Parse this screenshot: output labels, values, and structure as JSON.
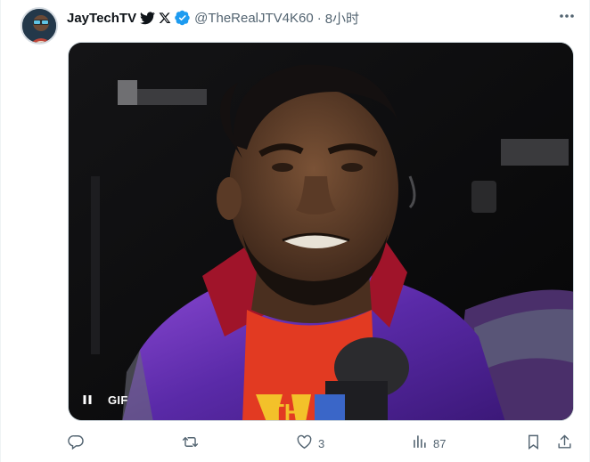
{
  "tweet": {
    "display_name": "JayTechTV",
    "name_icons": [
      "bird-icon",
      "x-logo-icon",
      "verified-badge-icon"
    ],
    "handle": "@TheRealJTV4K60",
    "separator": "·",
    "time": "8小时",
    "more_icon": "more-icon"
  },
  "media": {
    "type": "GIF",
    "gif_label": "GIF",
    "pause_icon": "pause-icon",
    "shirt_text": "TH"
  },
  "actions": {
    "reply": {
      "icon": "reply-icon",
      "count": ""
    },
    "retweet": {
      "icon": "retweet-icon",
      "count": ""
    },
    "like": {
      "icon": "heart-icon",
      "count": "3"
    },
    "views": {
      "icon": "views-icon",
      "count": "87"
    },
    "bookmark": {
      "icon": "bookmark-icon"
    },
    "share": {
      "icon": "share-icon"
    }
  },
  "colors": {
    "text_primary": "#0f1419",
    "text_secondary": "#536471",
    "verified_blue": "#1d9bf0",
    "border": "#cfd9de"
  }
}
